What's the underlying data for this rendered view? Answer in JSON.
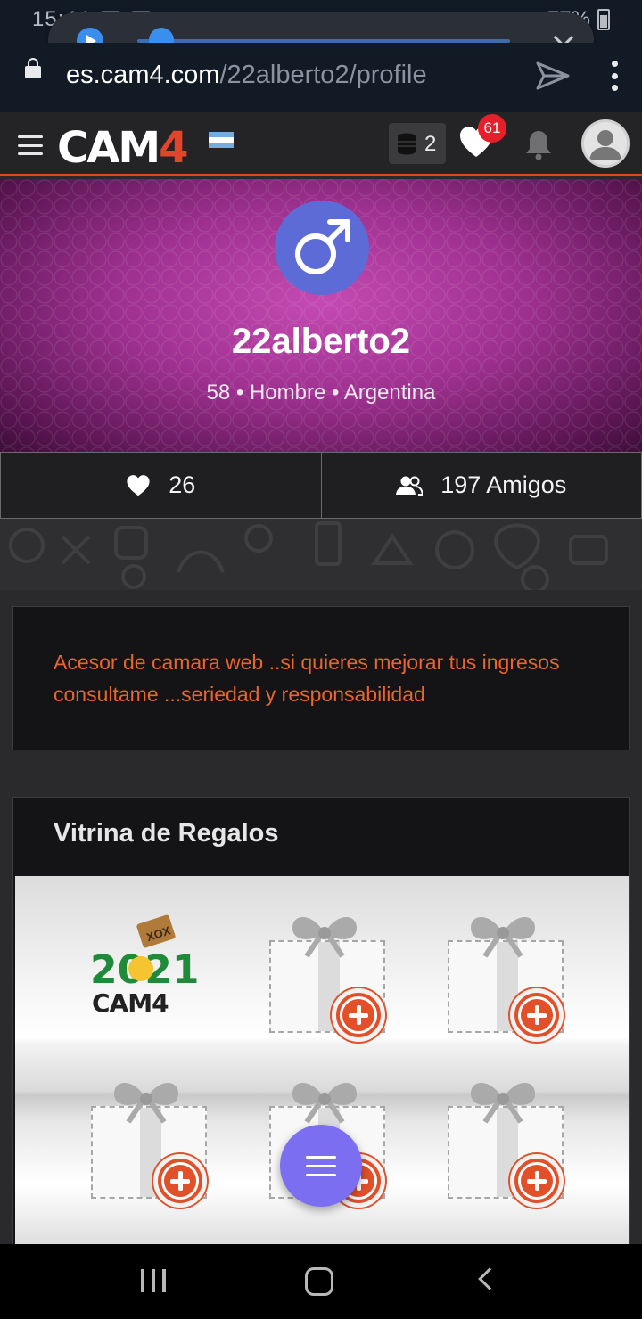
{
  "status_bar": {
    "time": "15:44",
    "battery": "77%"
  },
  "media_player": {
    "state": "paused",
    "progress": 0.06
  },
  "browser": {
    "url_domain": "es.cam4.com",
    "url_path": "/22alberto2/profile"
  },
  "header": {
    "logo_main": "CAM",
    "logo_accent": "4",
    "tokens_count": "2",
    "notifications_badge": "61",
    "colors": {
      "accent": "#e3452a",
      "badge": "#e4202a"
    }
  },
  "profile": {
    "gender_symbol": "♂",
    "username": "22alberto2",
    "meta": "58 • Hombre • Argentina",
    "likes": "26",
    "friends": "197 Amigos",
    "bio": "Acesor de camara web ..si quieres mejorar tus ingresos consultame ...seriedad y responsabilidad"
  },
  "gifts": {
    "title": "Vitrina de Regalos",
    "featured": {
      "top_tag": "XOX",
      "year": "2021",
      "brand": "CAM4"
    },
    "empty_slots": 5
  }
}
